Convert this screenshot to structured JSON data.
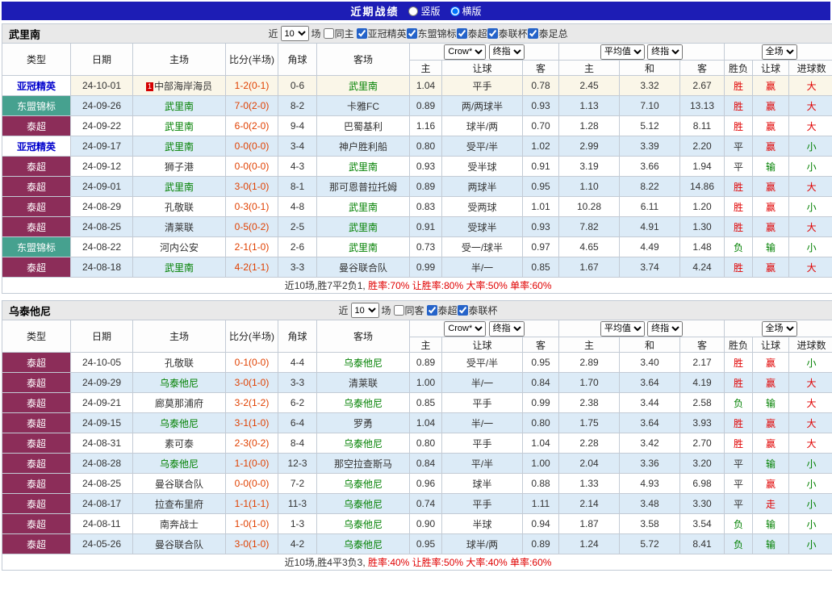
{
  "colors": {
    "topbar_bg": "#1d1db5",
    "league_thai_bg": "#8c2d59",
    "league_asean_bg": "#46a18f",
    "league_acl_text": "#0000cc",
    "team_green": "#008000",
    "score_red": "#e04000",
    "result_red": "#e00000",
    "result_green": "#008000",
    "row_alt_bg": "#dcebf7",
    "row_highlight_bg": "#faf6e8"
  },
  "header": {
    "title": "近期战绩",
    "layout_vertical": "竖版",
    "layout_horizontal": "横版",
    "selected_layout": "横版"
  },
  "table_head": {
    "type": "类型",
    "date": "日期",
    "home": "主场",
    "score": "比分(半场)",
    "corner": "角球",
    "away": "客场",
    "odds_group": {
      "select1": "Crow*",
      "select2": "终指",
      "cols": [
        "主",
        "让球",
        "客"
      ]
    },
    "avg_group": {
      "select1": "平均值",
      "select2": "终指",
      "cols": [
        "主",
        "和",
        "客"
      ]
    },
    "result_group": {
      "select": "全场",
      "cols": [
        "胜负",
        "让球",
        "进球数"
      ]
    }
  },
  "sections": [
    {
      "team": "武里南",
      "filter": {
        "near": "近",
        "count": "10",
        "games": "场",
        "same": "同主",
        "same_checked": false,
        "leagues": [
          {
            "label": "亚冠精英",
            "checked": true
          },
          {
            "label": "东盟锦标",
            "checked": true
          },
          {
            "label": "泰超",
            "checked": true
          },
          {
            "label": "泰联杯",
            "checked": true
          },
          {
            "label": "泰足总",
            "checked": true
          }
        ]
      },
      "rows": [
        {
          "lg": "亚冠精英",
          "lgc": "acl",
          "date": "24-10-01",
          "home": "中部海岸海员",
          "hbadge": "1",
          "ht": false,
          "score": "1-2(0-1)",
          "corner": "0-6",
          "away": "武里南",
          "at": true,
          "o1": "1.04",
          "o2": "平手",
          "o3": "0.78",
          "a1": "2.45",
          "a2": "3.32",
          "a3": "2.67",
          "r1": "胜",
          "r1c": "r",
          "r2": "赢",
          "r2c": "r",
          "r3": "大",
          "r3c": "r",
          "hl": true
        },
        {
          "lg": "东盟锦标",
          "lgc": "asean",
          "date": "24-09-26",
          "home": "武里南",
          "ht": true,
          "score": "7-0(2-0)",
          "corner": "8-2",
          "away": "卡雅FC",
          "at": false,
          "o1": "0.89",
          "o2": "两/两球半",
          "o3": "0.93",
          "a1": "1.13",
          "a2": "7.10",
          "a3": "13.13",
          "r1": "胜",
          "r1c": "r",
          "r2": "赢",
          "r2c": "r",
          "r3": "大",
          "r3c": "r"
        },
        {
          "lg": "泰超",
          "lgc": "thai",
          "date": "24-09-22",
          "home": "武里南",
          "ht": true,
          "score": "6-0(2-0)",
          "corner": "9-4",
          "away": "巴蜀基利",
          "at": false,
          "o1": "1.16",
          "o2": "球半/两",
          "o3": "0.70",
          "a1": "1.28",
          "a2": "5.12",
          "a3": "8.11",
          "r1": "胜",
          "r1c": "r",
          "r2": "赢",
          "r2c": "r",
          "r3": "大",
          "r3c": "r"
        },
        {
          "lg": "亚冠精英",
          "lgc": "acl",
          "date": "24-09-17",
          "home": "武里南",
          "ht": true,
          "score": "0-0(0-0)",
          "corner": "3-4",
          "away": "神户胜利船",
          "at": false,
          "o1": "0.80",
          "o2": "受平/半",
          "o3": "1.02",
          "a1": "2.99",
          "a2": "3.39",
          "a3": "2.20",
          "r1": "平",
          "r1c": "k",
          "r2": "赢",
          "r2c": "r",
          "r3": "小",
          "r3c": "g"
        },
        {
          "lg": "泰超",
          "lgc": "thai",
          "date": "24-09-12",
          "home": "狮子港",
          "ht": false,
          "score": "0-0(0-0)",
          "corner": "4-3",
          "away": "武里南",
          "at": true,
          "o1": "0.93",
          "o2": "受半球",
          "o3": "0.91",
          "a1": "3.19",
          "a2": "3.66",
          "a3": "1.94",
          "r1": "平",
          "r1c": "k",
          "r2": "输",
          "r2c": "g",
          "r3": "小",
          "r3c": "g"
        },
        {
          "lg": "泰超",
          "lgc": "thai",
          "date": "24-09-01",
          "home": "武里南",
          "ht": true,
          "score": "3-0(1-0)",
          "corner": "8-1",
          "away": "那可恩普拉托姆",
          "at": false,
          "o1": "0.89",
          "o2": "两球半",
          "o3": "0.95",
          "a1": "1.10",
          "a2": "8.22",
          "a3": "14.86",
          "r1": "胜",
          "r1c": "r",
          "r2": "赢",
          "r2c": "r",
          "r3": "大",
          "r3c": "r"
        },
        {
          "lg": "泰超",
          "lgc": "thai",
          "date": "24-08-29",
          "home": "孔敬联",
          "ht": false,
          "score": "0-3(0-1)",
          "corner": "4-8",
          "away": "武里南",
          "at": true,
          "o1": "0.83",
          "o2": "受两球",
          "o3": "1.01",
          "a1": "10.28",
          "a2": "6.11",
          "a3": "1.20",
          "r1": "胜",
          "r1c": "r",
          "r2": "赢",
          "r2c": "r",
          "r3": "小",
          "r3c": "g"
        },
        {
          "lg": "泰超",
          "lgc": "thai",
          "date": "24-08-25",
          "home": "清莱联",
          "ht": false,
          "score": "0-5(0-2)",
          "corner": "2-5",
          "away": "武里南",
          "at": true,
          "o1": "0.91",
          "o2": "受球半",
          "o3": "0.93",
          "a1": "7.82",
          "a2": "4.91",
          "a3": "1.30",
          "r1": "胜",
          "r1c": "r",
          "r2": "赢",
          "r2c": "r",
          "r3": "大",
          "r3c": "r"
        },
        {
          "lg": "东盟锦标",
          "lgc": "asean",
          "date": "24-08-22",
          "home": "河内公安",
          "ht": false,
          "score": "2-1(1-0)",
          "corner": "2-6",
          "away": "武里南",
          "at": true,
          "o1": "0.73",
          "o2": "受一/球半",
          "o3": "0.97",
          "a1": "4.65",
          "a2": "4.49",
          "a3": "1.48",
          "r1": "负",
          "r1c": "g",
          "r2": "输",
          "r2c": "g",
          "r3": "小",
          "r3c": "g"
        },
        {
          "lg": "泰超",
          "lgc": "thai",
          "date": "24-08-18",
          "home": "武里南",
          "ht": true,
          "score": "4-2(1-1)",
          "corner": "3-3",
          "away": "曼谷联合队",
          "at": false,
          "o1": "0.99",
          "o2": "半/一",
          "o3": "0.85",
          "a1": "1.67",
          "a2": "3.74",
          "a3": "4.24",
          "r1": "胜",
          "r1c": "r",
          "r2": "赢",
          "r2c": "r",
          "r3": "大",
          "r3c": "r"
        }
      ],
      "summary": {
        "prefix": "近10场,胜7平2负1,",
        "stats": "胜率:70% 让胜率:80% 大率:50% 单率:60%"
      }
    },
    {
      "team": "乌泰他尼",
      "filter": {
        "near": "近",
        "count": "10",
        "games": "场",
        "same": "同客",
        "same_checked": false,
        "leagues": [
          {
            "label": "泰超",
            "checked": true
          },
          {
            "label": "泰联杯",
            "checked": true
          }
        ]
      },
      "rows": [
        {
          "lg": "泰超",
          "lgc": "thai",
          "date": "24-10-05",
          "home": "孔敬联",
          "ht": false,
          "score": "0-1(0-0)",
          "corner": "4-4",
          "away": "乌泰他尼",
          "at": true,
          "o1": "0.89",
          "o2": "受平/半",
          "o3": "0.95",
          "a1": "2.89",
          "a2": "3.40",
          "a3": "2.17",
          "r1": "胜",
          "r1c": "r",
          "r2": "赢",
          "r2c": "r",
          "r3": "小",
          "r3c": "g"
        },
        {
          "lg": "泰超",
          "lgc": "thai",
          "date": "24-09-29",
          "home": "乌泰他尼",
          "ht": true,
          "score": "3-0(1-0)",
          "corner": "3-3",
          "away": "清莱联",
          "at": false,
          "o1": "1.00",
          "o2": "半/一",
          "o3": "0.84",
          "a1": "1.70",
          "a2": "3.64",
          "a3": "4.19",
          "r1": "胜",
          "r1c": "r",
          "r2": "赢",
          "r2c": "r",
          "r3": "大",
          "r3c": "r"
        },
        {
          "lg": "泰超",
          "lgc": "thai",
          "date": "24-09-21",
          "home": "廊莫那浦府",
          "ht": false,
          "score": "3-2(1-2)",
          "corner": "6-2",
          "away": "乌泰他尼",
          "at": true,
          "o1": "0.85",
          "o2": "平手",
          "o3": "0.99",
          "a1": "2.38",
          "a2": "3.44",
          "a3": "2.58",
          "r1": "负",
          "r1c": "g",
          "r2": "输",
          "r2c": "g",
          "r3": "大",
          "r3c": "r"
        },
        {
          "lg": "泰超",
          "lgc": "thai",
          "date": "24-09-15",
          "home": "乌泰他尼",
          "ht": true,
          "score": "3-1(1-0)",
          "corner": "6-4",
          "away": "罗勇",
          "at": false,
          "o1": "1.04",
          "o2": "半/一",
          "o3": "0.80",
          "a1": "1.75",
          "a2": "3.64",
          "a3": "3.93",
          "r1": "胜",
          "r1c": "r",
          "r2": "赢",
          "r2c": "r",
          "r3": "大",
          "r3c": "r"
        },
        {
          "lg": "泰超",
          "lgc": "thai",
          "date": "24-08-31",
          "home": "素可泰",
          "ht": false,
          "score": "2-3(0-2)",
          "corner": "8-4",
          "away": "乌泰他尼",
          "at": true,
          "o1": "0.80",
          "o2": "平手",
          "o3": "1.04",
          "a1": "2.28",
          "a2": "3.42",
          "a3": "2.70",
          "r1": "胜",
          "r1c": "r",
          "r2": "赢",
          "r2c": "r",
          "r3": "大",
          "r3c": "r"
        },
        {
          "lg": "泰超",
          "lgc": "thai",
          "date": "24-08-28",
          "home": "乌泰他尼",
          "ht": true,
          "score": "1-1(0-0)",
          "corner": "12-3",
          "away": "那空拉查斯马",
          "at": false,
          "o1": "0.84",
          "o2": "平/半",
          "o3": "1.00",
          "a1": "2.04",
          "a2": "3.36",
          "a3": "3.20",
          "r1": "平",
          "r1c": "k",
          "r2": "输",
          "r2c": "g",
          "r3": "小",
          "r3c": "g"
        },
        {
          "lg": "泰超",
          "lgc": "thai",
          "date": "24-08-25",
          "home": "曼谷联合队",
          "ht": false,
          "score": "0-0(0-0)",
          "corner": "7-2",
          "away": "乌泰他尼",
          "at": true,
          "o1": "0.96",
          "o2": "球半",
          "o3": "0.88",
          "a1": "1.33",
          "a2": "4.93",
          "a3": "6.98",
          "r1": "平",
          "r1c": "k",
          "r2": "赢",
          "r2c": "r",
          "r3": "小",
          "r3c": "g"
        },
        {
          "lg": "泰超",
          "lgc": "thai",
          "date": "24-08-17",
          "home": "拉查布里府",
          "ht": false,
          "score": "1-1(1-1)",
          "corner": "11-3",
          "away": "乌泰他尼",
          "at": true,
          "o1": "0.74",
          "o2": "平手",
          "o3": "1.11",
          "a1": "2.14",
          "a2": "3.48",
          "a3": "3.30",
          "r1": "平",
          "r1c": "k",
          "r2": "走",
          "r2c": "r",
          "r3": "小",
          "r3c": "g"
        },
        {
          "lg": "泰超",
          "lgc": "thai",
          "date": "24-08-11",
          "home": "南奔战士",
          "ht": false,
          "score": "1-0(1-0)",
          "corner": "1-3",
          "away": "乌泰他尼",
          "at": true,
          "o1": "0.90",
          "o2": "半球",
          "o3": "0.94",
          "a1": "1.87",
          "a2": "3.58",
          "a3": "3.54",
          "r1": "负",
          "r1c": "g",
          "r2": "输",
          "r2c": "g",
          "r3": "小",
          "r3c": "g"
        },
        {
          "lg": "泰超",
          "lgc": "thai",
          "date": "24-05-26",
          "home": "曼谷联合队",
          "ht": false,
          "score": "3-0(1-0)",
          "corner": "4-2",
          "away": "乌泰他尼",
          "at": true,
          "o1": "0.95",
          "o2": "球半/两",
          "o3": "0.89",
          "a1": "1.24",
          "a2": "5.72",
          "a3": "8.41",
          "r1": "负",
          "r1c": "g",
          "r2": "输",
          "r2c": "g",
          "r3": "小",
          "r3c": "g"
        }
      ],
      "summary": {
        "prefix": "近10场,胜4平3负3,",
        "stats": "胜率:40% 让胜率:50% 大率:40% 单率:60%"
      }
    }
  ]
}
